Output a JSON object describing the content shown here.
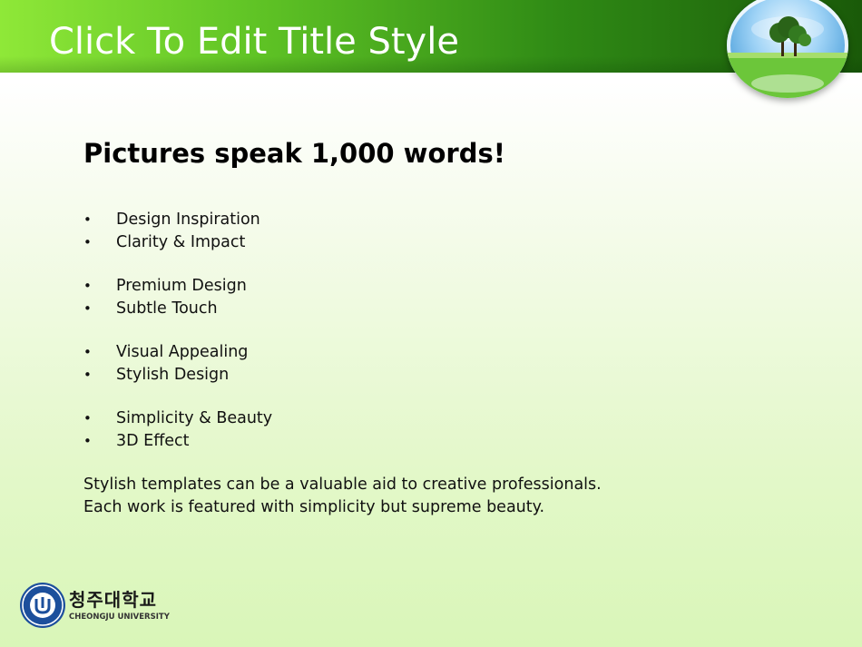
{
  "slide": {
    "title": "Click To Edit Title Style",
    "heading": "Pictures speak 1,000 words!",
    "bullet_symbol": "•",
    "bullets": [
      "Design Inspiration",
      "Clarity & Impact",
      "Premium Design",
      "Subtle Touch",
      "Visual Appealing",
      "Stylish Design",
      "Simplicity & Beauty",
      "3D Effect"
    ],
    "paragraph": [
      "Stylish templates can be a valuable aid to creative professionals.",
      "Each work is featured with simplicity but supreme beauty."
    ]
  },
  "logo": {
    "korean_name": "청주대학교",
    "english_name": "CHEONGJU UNIVERSITY"
  },
  "colors": {
    "header_light": "#8fe838",
    "header_dark": "#1a5a09",
    "background_green": "#d9f6b8",
    "logo_blue": "#1c4f9c"
  }
}
